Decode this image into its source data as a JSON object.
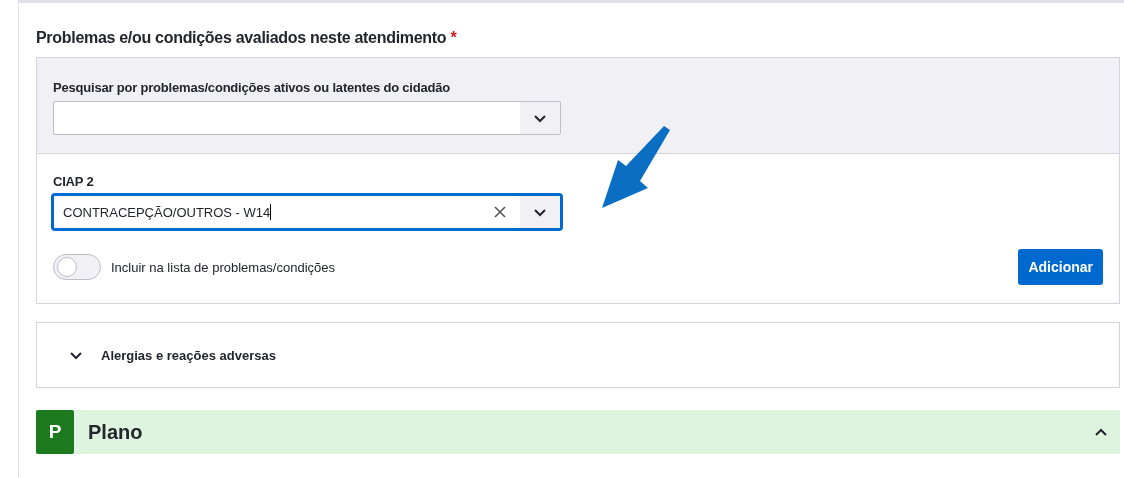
{
  "section": {
    "title": "Problemas e/ou condições avaliados neste atendimento",
    "required_mark": "*"
  },
  "search": {
    "label": "Pesquisar por problemas/condições ativos ou latentes do cidadão"
  },
  "ciap": {
    "label": "CIAP 2",
    "value": "CONTRACEPÇÃO/OUTROS - W14",
    "focused": true
  },
  "toggle": {
    "label": "Incluir na lista de problemas/condições",
    "on": false
  },
  "add_button": "Adicionar",
  "accordions": [
    {
      "title": "Alergias e reações adversas",
      "expanded": false
    }
  ],
  "plano": {
    "badge": "P",
    "title": "Plano",
    "expanded": true
  }
}
